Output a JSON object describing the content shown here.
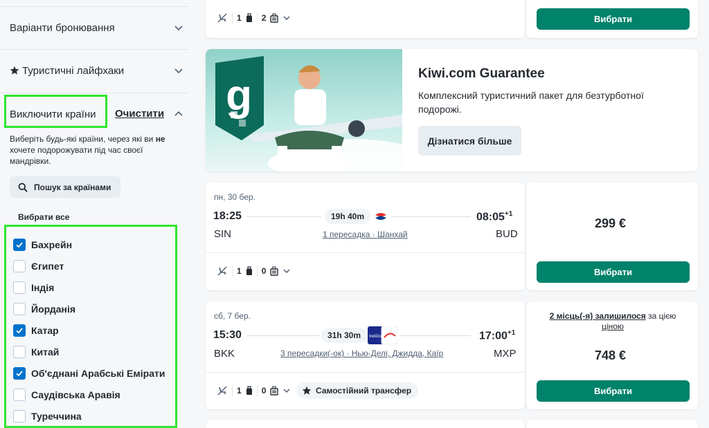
{
  "sidebar": {
    "booking_options": "Варіанти бронювання",
    "travel_hacks": "Туристичні лайфхаки",
    "exclude_countries": "Виключити країни",
    "clear": "Очистити",
    "desc_part1": "Виберіть будь-які країни, через які ви ",
    "desc_bold": "не",
    "desc_part2": " хочете подорожувати під час своєї мандрівки.",
    "search_countries": "Пошук за країнами",
    "select_all": "Вибрати все",
    "countries": [
      {
        "name": "Бахрейн",
        "checked": true
      },
      {
        "name": "Єгипет",
        "checked": false
      },
      {
        "name": "Індія",
        "checked": false
      },
      {
        "name": "Йорданія",
        "checked": false
      },
      {
        "name": "Катар",
        "checked": true
      },
      {
        "name": "Китай",
        "checked": false
      },
      {
        "name": "Об'єднані Арабські Емірати",
        "checked": true
      },
      {
        "name": "Саудівська Аравія",
        "checked": false
      },
      {
        "name": "Туреччина",
        "checked": false
      }
    ]
  },
  "top_card": {
    "cabin_bags": "1",
    "checked_bags": "2",
    "select": "Вибрати"
  },
  "promo": {
    "title": "Kiwi.com Guarantee",
    "text": "Комплексний туристичний пакет для безтурботної подорожі.",
    "button": "Дізнатися більше"
  },
  "flights": [
    {
      "date": "пн, 30 бер.",
      "dep_time": "18:25",
      "duration": "19h 40m",
      "arr_time": "08:05",
      "arr_plus": "+1",
      "from": "SIN",
      "to": "BUD",
      "stops": "1 пересадка · Шанхай",
      "cabin_bags": "1",
      "checked_bags": "0",
      "price": "299 €",
      "select": "Вибрати"
    },
    {
      "date": "сб, 7 бер.",
      "dep_time": "15:30",
      "duration": "31h 30m",
      "arr_time": "17:00",
      "arr_plus": "+1",
      "from": "BKK",
      "to": "MXP",
      "stops": "3 пересадки(-ок) · Нью-Делі, Джидда, Каїр",
      "cabin_bags": "1",
      "checked_bags": "0",
      "transfer": "Самостійний трансфер",
      "seats_left": "2 місць(-я) залишилося",
      "seats_tail": " за цією",
      "seats_tail2": "ціною",
      "price": "748 €",
      "select": "Вибрати"
    }
  ],
  "colors": {
    "accent": "#00826b",
    "checkbox": "#0172cb",
    "highlight": "#2ee62e"
  }
}
